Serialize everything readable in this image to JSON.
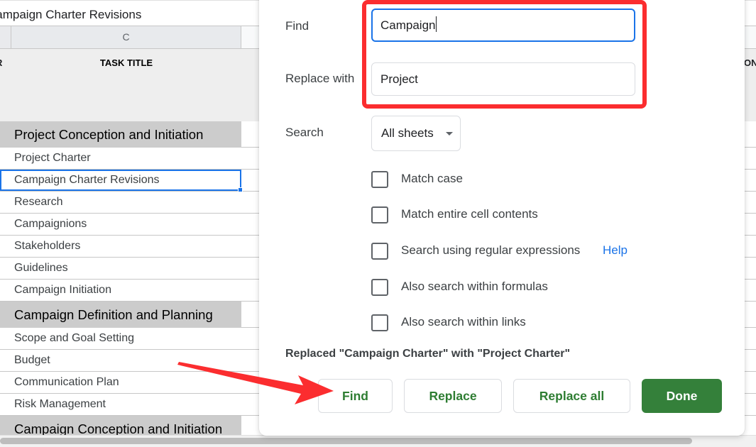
{
  "formula_bar": {
    "value": "Campaign Charter Revisions"
  },
  "column_headers": {
    "visible_column": "C"
  },
  "header_row": {
    "left_fragment": "R",
    "task_title": "TASK TITLE",
    "right_fragment": "ON"
  },
  "rows": [
    {
      "text": "Project Conception and Initiation",
      "type": "section"
    },
    {
      "text": "Project Charter",
      "type": "task"
    },
    {
      "text": "Campaign Charter Revisions",
      "type": "task",
      "selected": true
    },
    {
      "text": "Research",
      "type": "task"
    },
    {
      "text": "Campaignions",
      "type": "task"
    },
    {
      "text": "Stakeholders",
      "type": "task"
    },
    {
      "text": "Guidelines",
      "type": "task"
    },
    {
      "text": "Campaign Initiation",
      "type": "task"
    },
    {
      "text": "Campaign Definition and Planning",
      "type": "section"
    },
    {
      "text": "Scope and Goal Setting",
      "type": "task"
    },
    {
      "text": "Budget",
      "type": "task"
    },
    {
      "text": "Communication Plan",
      "type": "task"
    },
    {
      "text": "Risk Management",
      "type": "task"
    },
    {
      "text": "Campaign Conception and Initiation",
      "type": "section"
    }
  ],
  "dialog": {
    "find_label": "Find",
    "find_value": "Campaign",
    "replace_label": "Replace with",
    "replace_value": "Project",
    "search_label": "Search",
    "search_scope": "All sheets",
    "options": [
      {
        "label": "Match case",
        "checked": false
      },
      {
        "label": "Match entire cell contents",
        "checked": false
      },
      {
        "label": "Search using regular expressions",
        "checked": false
      },
      {
        "label": "Also search within formulas",
        "checked": false
      },
      {
        "label": "Also search within links",
        "checked": false
      }
    ],
    "help_link": "Help",
    "status_message": "Replaced \"Campaign Charter\" with \"Project Charter\"",
    "buttons": {
      "find": "Find",
      "replace": "Replace",
      "replace_all": "Replace all",
      "done": "Done"
    }
  },
  "colors": {
    "accent_blue": "#1a73e8",
    "button_green": "#2e7d32",
    "done_green": "#34803a",
    "annotation_red": "#fb2d2f",
    "section_gray": "#cccccc"
  }
}
